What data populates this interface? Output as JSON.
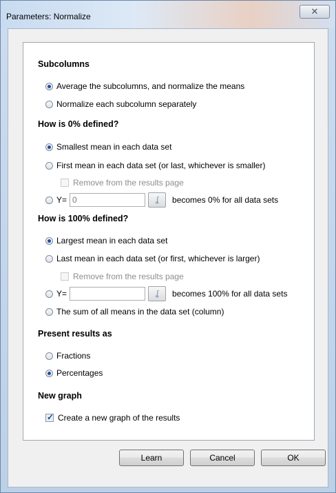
{
  "window": {
    "title": "Parameters: Normalize",
    "close_glyph": "✕"
  },
  "subcolumns": {
    "title": "Subcolumns",
    "options": [
      {
        "label": "Average the subcolumns, and normalize the means",
        "selected": true
      },
      {
        "label": "Normalize each subcolumn separately",
        "selected": false
      }
    ]
  },
  "zero": {
    "title": "How is 0% defined?",
    "options": [
      {
        "label": "Smallest mean in each data set",
        "selected": true
      },
      {
        "label": "First mean in each data set (or last, whichever is smaller)",
        "selected": false
      }
    ],
    "remove_label": "Remove from the results page",
    "remove_checked": false,
    "y_prefix": "Y=",
    "y_value": "0",
    "y_suffix": "becomes 0% for all data sets"
  },
  "hundred": {
    "title": "How is 100% defined?",
    "options": [
      {
        "label": "Largest mean in each data set",
        "selected": true
      },
      {
        "label": "Last mean in each data set (or first, whichever is larger)",
        "selected": false
      }
    ],
    "remove_label": "Remove from the results page",
    "remove_checked": false,
    "y_prefix": "Y=",
    "y_value": "",
    "y_suffix": "becomes 100% for all data sets",
    "sum_label": "The sum of all means in the data set (column)"
  },
  "present": {
    "title": "Present results as",
    "options": [
      {
        "label": "Fractions",
        "selected": false
      },
      {
        "label": "Percentages",
        "selected": true
      }
    ]
  },
  "graph": {
    "title": "New graph",
    "create_label": "Create a new graph of the results",
    "create_checked": true
  },
  "buttons": {
    "learn": "Learn",
    "cancel": "Cancel",
    "ok": "OK"
  },
  "icons": {
    "titlebar_close": "close-icon",
    "value_picker": "hook-picker-icon"
  }
}
